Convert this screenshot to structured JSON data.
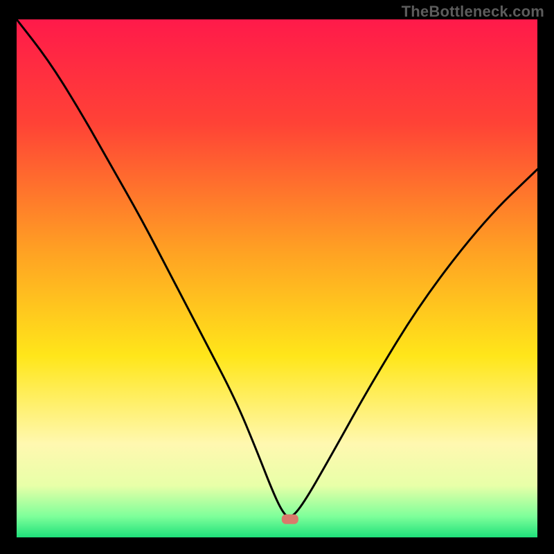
{
  "watermark": "TheBottleneck.com",
  "chart_data": {
    "type": "line",
    "title": "",
    "xlabel": "",
    "ylabel": "",
    "xlim": [
      0,
      100
    ],
    "ylim": [
      0,
      100
    ],
    "background_gradient": {
      "stops": [
        {
          "offset": 0,
          "color": "#ff1a4a"
        },
        {
          "offset": 20,
          "color": "#ff4236"
        },
        {
          "offset": 45,
          "color": "#ffa223"
        },
        {
          "offset": 65,
          "color": "#ffe61a"
        },
        {
          "offset": 82,
          "color": "#fff8b0"
        },
        {
          "offset": 90,
          "color": "#e8ffa8"
        },
        {
          "offset": 96,
          "color": "#7dff9a"
        },
        {
          "offset": 100,
          "color": "#1ee07a"
        }
      ]
    },
    "curve": {
      "x": [
        0,
        6,
        12,
        18,
        24,
        30,
        36,
        42,
        46,
        49,
        51,
        52.5,
        55,
        60,
        68,
        78,
        90,
        100
      ],
      "y_percent": [
        100,
        92,
        82,
        71,
        60,
        48,
        36,
        24,
        14,
        6,
        1.5,
        0,
        3,
        12,
        27,
        44,
        60,
        70
      ]
    },
    "marker": {
      "x": 52.5,
      "y_percent": 0,
      "color": "#d97a6b"
    }
  }
}
